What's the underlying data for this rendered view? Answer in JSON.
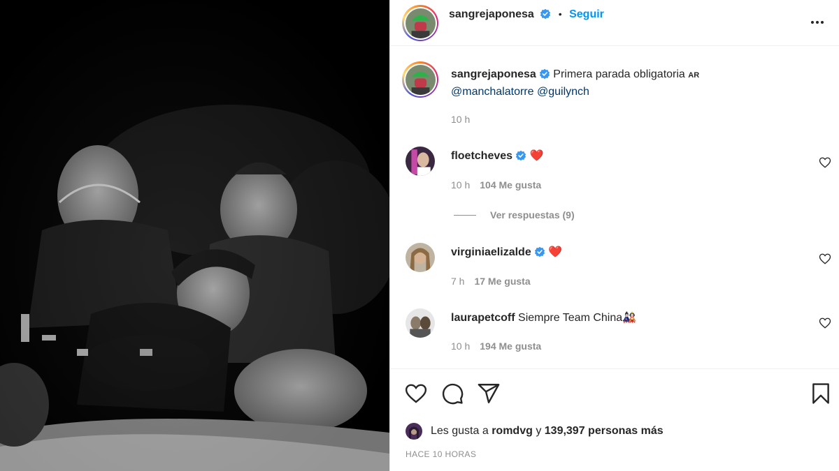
{
  "post": {
    "author": "sangrejaponesa",
    "follow_label": "Seguir",
    "more_icon": "more-options-icon"
  },
  "caption": {
    "author": "sangrejaponesa",
    "text": "Primera parada obligatoria",
    "flag": "AR",
    "mention_1": "@manchalatorre",
    "mention_2": "@guilynch",
    "time": "10 h"
  },
  "comments": [
    {
      "user": "floetcheves",
      "text": "❤️",
      "time": "10 h",
      "likes": "104 Me gusta",
      "replies": "Ver respuestas (9)",
      "verified": true
    },
    {
      "user": "virginiaelizalde",
      "text": "❤️",
      "time": "7 h",
      "likes": "17 Me gusta",
      "verified": true
    },
    {
      "user": "laurapetcoff",
      "text": "Siempre Team China🎎",
      "time": "10 h",
      "likes": "194 Me gusta",
      "verified": false
    }
  ],
  "actions": {
    "like_icon": "heart-icon",
    "comment_icon": "comment-icon",
    "share_icon": "share-icon",
    "save_icon": "bookmark-icon"
  },
  "likes": {
    "prefix": "Les gusta a",
    "user": "romdvg",
    "middle": "y",
    "count": "139,397 personas más"
  },
  "timestamp": "HACE 10 HORAS",
  "colors": {
    "link": "#0095f6",
    "verified": "#3897f0",
    "heart": "#ed4956"
  }
}
